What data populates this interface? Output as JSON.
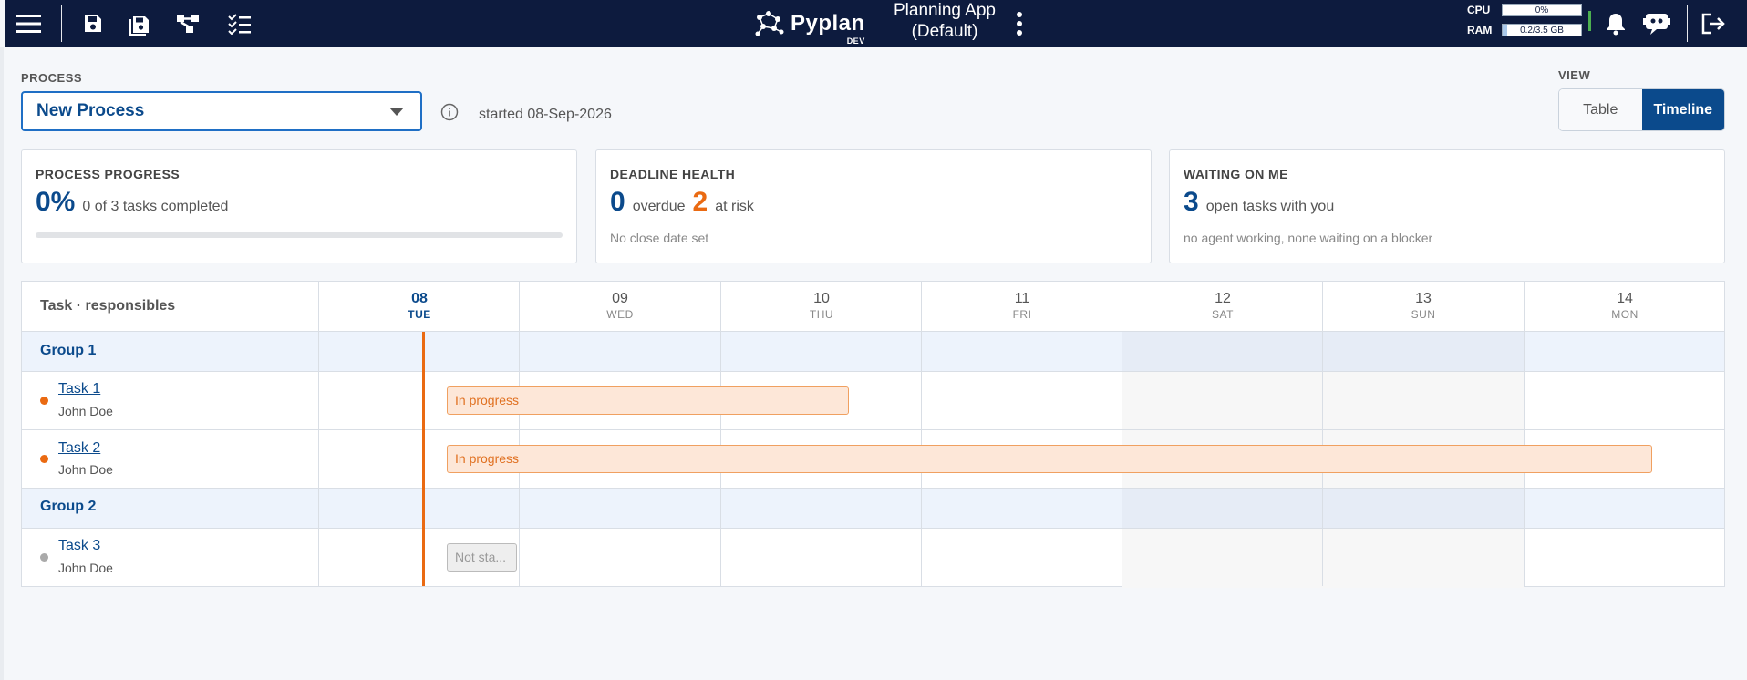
{
  "topbar": {
    "icons": [
      "menu-icon",
      "save-icon",
      "save-as-icon",
      "flow-icon",
      "checklist-icon"
    ],
    "logo": {
      "name": "Pyplan",
      "badge": "DEV"
    },
    "app_title": "Planning App (Default)",
    "cpu": {
      "label": "CPU",
      "value": "0%",
      "fraction": 0.0
    },
    "ram": {
      "label": "RAM",
      "value": "0.2/3.5 GB",
      "fraction": 0.06
    },
    "right_icons": [
      "bell-icon",
      "assistant-icon",
      "logout-icon"
    ]
  },
  "process": {
    "label": "PROCESS",
    "selected": "New Process",
    "started": "started 08-Sep-2026"
  },
  "view": {
    "label": "VIEW",
    "options": [
      "Table",
      "Timeline"
    ],
    "active": "Timeline"
  },
  "cards": {
    "progress": {
      "title": "PROCESS PROGRESS",
      "value": "0%",
      "text": "0 of 3 tasks completed",
      "fraction": 0.0
    },
    "deadline": {
      "title": "DEADLINE HEALTH",
      "overdue_value": "0",
      "overdue_text": "overdue",
      "risk_value": "2",
      "risk_text": "at risk",
      "sub": "No close date set"
    },
    "waiting": {
      "title": "WAITING ON ME",
      "value": "3",
      "text": "open tasks with you",
      "sub": "no agent working, none waiting on a blocker"
    }
  },
  "timeline": {
    "header_label": "Task · responsibles",
    "days": [
      {
        "num": "08",
        "dow": "TUE"
      },
      {
        "num": "09",
        "dow": "WED"
      },
      {
        "num": "10",
        "dow": "THU"
      },
      {
        "num": "11",
        "dow": "FRI"
      },
      {
        "num": "12",
        "dow": "SAT"
      },
      {
        "num": "13",
        "dow": "SUN"
      },
      {
        "num": "14",
        "dow": "MON"
      }
    ],
    "groups": [
      {
        "name": "Group 1"
      },
      {
        "name": "Group 2"
      }
    ],
    "tasks": [
      {
        "name": "Task 1",
        "owner": "John Doe",
        "status": "In progress",
        "color": "#ea6a12"
      },
      {
        "name": "Task 2",
        "owner": "John Doe",
        "status": "In progress",
        "color": "#ea6a12"
      },
      {
        "name": "Task 3",
        "owner": "John Doe",
        "status": "Not sta...",
        "color": "#aaaaaa"
      }
    ]
  }
}
